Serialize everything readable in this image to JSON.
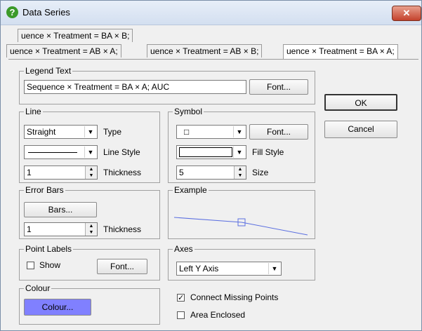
{
  "window": {
    "title": "Data Series",
    "close_label": "✕"
  },
  "tabs": [
    "uence × Treatment = BA × B;",
    "uence × Treatment = AB × A;",
    "uence × Treatment = AB × B;",
    "uence × Treatment = BA × A;"
  ],
  "legend": {
    "title": "Legend Text",
    "value": "Sequence × Treatment = BA × A; AUC",
    "font_label": "Font..."
  },
  "line": {
    "title": "Line",
    "type_value": "Straight",
    "type_label": "Type",
    "style_label": "Line Style",
    "thickness_value": "1",
    "thickness_label": "Thickness"
  },
  "symbol": {
    "title": "Symbol",
    "symbol_value": "□",
    "font_label": "Font...",
    "fill_label": "Fill Style",
    "size_value": "5",
    "size_label": "Size"
  },
  "error_bars": {
    "title": "Error Bars",
    "bars_label": "Bars...",
    "thickness_value": "1",
    "thickness_label": "Thickness"
  },
  "example": {
    "title": "Example"
  },
  "point_labels": {
    "title": "Point Labels",
    "show_label": "Show",
    "font_label": "Font..."
  },
  "axes": {
    "title": "Axes",
    "value": "Left Y Axis"
  },
  "colour": {
    "title": "Colour",
    "button_label": "Colour...",
    "button_color": "#8080ff"
  },
  "options": {
    "connect_missing_label": "Connect Missing Points",
    "connect_missing_checked": true,
    "area_enclosed_label": "Area Enclosed",
    "area_enclosed_checked": false
  },
  "buttons": {
    "ok": "OK",
    "cancel": "Cancel"
  },
  "colors": {
    "example_line": "#5b6fe0"
  }
}
